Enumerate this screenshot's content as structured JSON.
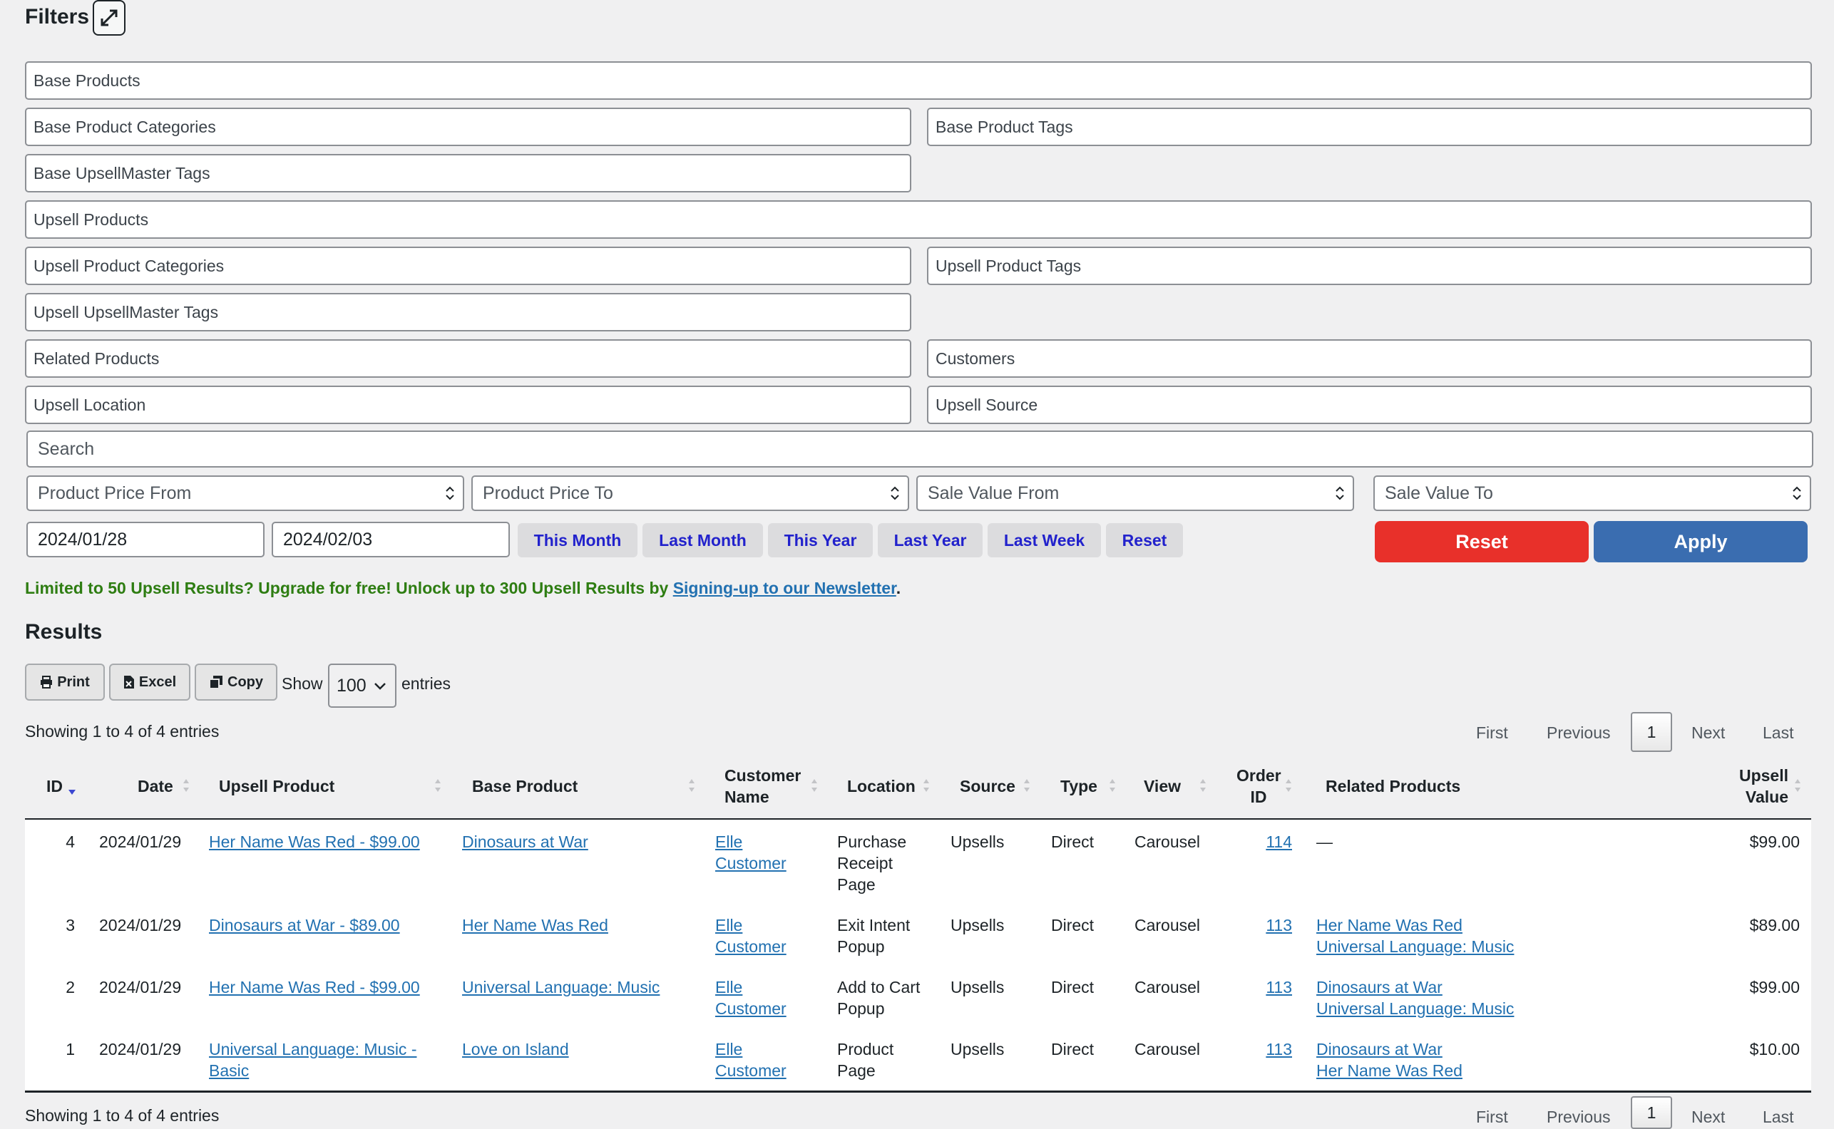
{
  "filters": {
    "title": "Filters",
    "fields": {
      "base_products": "Base Products",
      "base_product_categories": "Base Product Categories",
      "base_product_tags": "Base Product Tags",
      "base_upsellmaster_tags": "Base UpsellMaster Tags",
      "upsell_products": "Upsell Products",
      "upsell_product_categories": "Upsell Product Categories",
      "upsell_product_tags": "Upsell Product Tags",
      "upsell_upsellmaster_tags": "Upsell UpsellMaster Tags",
      "related_products": "Related Products",
      "customers": "Customers",
      "upsell_location": "Upsell Location",
      "upsell_source": "Upsell Source"
    },
    "search_placeholder": "Search",
    "product_price_from": "Product Price From",
    "product_price_to": "Product Price To",
    "sale_value_from": "Sale Value From",
    "sale_value_to": "Sale Value To",
    "date_from": "2024/01/28",
    "date_to": "2024/02/03",
    "quick_ranges": [
      "This Month",
      "Last Month",
      "This Year",
      "Last Year",
      "Last Week",
      "Reset"
    ],
    "reset_label": "Reset",
    "apply_label": "Apply",
    "reset_color": "#e8302a",
    "apply_color": "#3a6db0"
  },
  "notice": {
    "text": "Limited to 50 Upsell Results? Upgrade for free! Unlock up to 300 Upsell Results by ",
    "link": "Signing-up to our Newsletter",
    "end": "."
  },
  "results": {
    "title": "Results",
    "print_label": "Print",
    "excel_label": "Excel",
    "copy_label": "Copy",
    "show_label": "Show",
    "entries_value": "100",
    "entries_label": "entries",
    "showing_text": "Showing 1 to 4 of 4 entries",
    "pager": {
      "first": "First",
      "previous": "Previous",
      "current": "1",
      "next": "Next",
      "last": "Last"
    },
    "columns": {
      "id": "ID",
      "date": "Date",
      "upsell_product": "Upsell Product",
      "base_product": "Base Product",
      "customer_name_1": "Customer",
      "customer_name_2": "Name",
      "location": "Location",
      "source": "Source",
      "type": "Type",
      "view": "View",
      "order_id_1": "Order",
      "order_id_2": "ID",
      "related_products": "Related Products",
      "upsell_value_1": "Upsell",
      "upsell_value_2": "Value"
    },
    "rows": [
      {
        "id": "4",
        "date": "2024/01/29",
        "upsell_product_1": "Her Name Was Red - $99.00",
        "upsell_product_2": "",
        "base_product": "Dinosaurs at War",
        "customer_1": "Elle",
        "customer_2": "Customer",
        "location_1": "Purchase",
        "location_2": "Receipt",
        "location_3": "Page",
        "source": "Upsells",
        "type": "Direct",
        "view": "Carousel",
        "order_id": "114",
        "related_1": "—",
        "related_2": "",
        "value": "$99.00"
      },
      {
        "id": "3",
        "date": "2024/01/29",
        "upsell_product_1": "Dinosaurs at War - $89.00",
        "upsell_product_2": "",
        "base_product": "Her Name Was Red",
        "customer_1": "Elle",
        "customer_2": "Customer",
        "location_1": "Exit Intent",
        "location_2": "Popup",
        "location_3": "",
        "source": "Upsells",
        "type": "Direct",
        "view": "Carousel",
        "order_id": "113",
        "related_1": "Her Name Was Red",
        "related_2": "Universal Language: Music",
        "value": "$89.00"
      },
      {
        "id": "2",
        "date": "2024/01/29",
        "upsell_product_1": "Her Name Was Red - $99.00",
        "upsell_product_2": "",
        "base_product": "Universal Language: Music",
        "customer_1": "Elle",
        "customer_2": "Customer",
        "location_1": "Add to Cart",
        "location_2": "Popup",
        "location_3": "",
        "source": "Upsells",
        "type": "Direct",
        "view": "Carousel",
        "order_id": "113",
        "related_1": "Dinosaurs at War",
        "related_2": "Universal Language: Music",
        "value": "$99.00"
      },
      {
        "id": "1",
        "date": "2024/01/29",
        "upsell_product_1": "Universal Language: Music -",
        "upsell_product_2": "Basic",
        "base_product": "Love on Island",
        "customer_1": "Elle",
        "customer_2": "Customer",
        "location_1": "Product",
        "location_2": "Page",
        "location_3": "",
        "source": "Upsells",
        "type": "Direct",
        "view": "Carousel",
        "order_id": "113",
        "related_1": "Dinosaurs at War",
        "related_2": "Her Name Was Red",
        "value": "$10.00"
      }
    ]
  }
}
